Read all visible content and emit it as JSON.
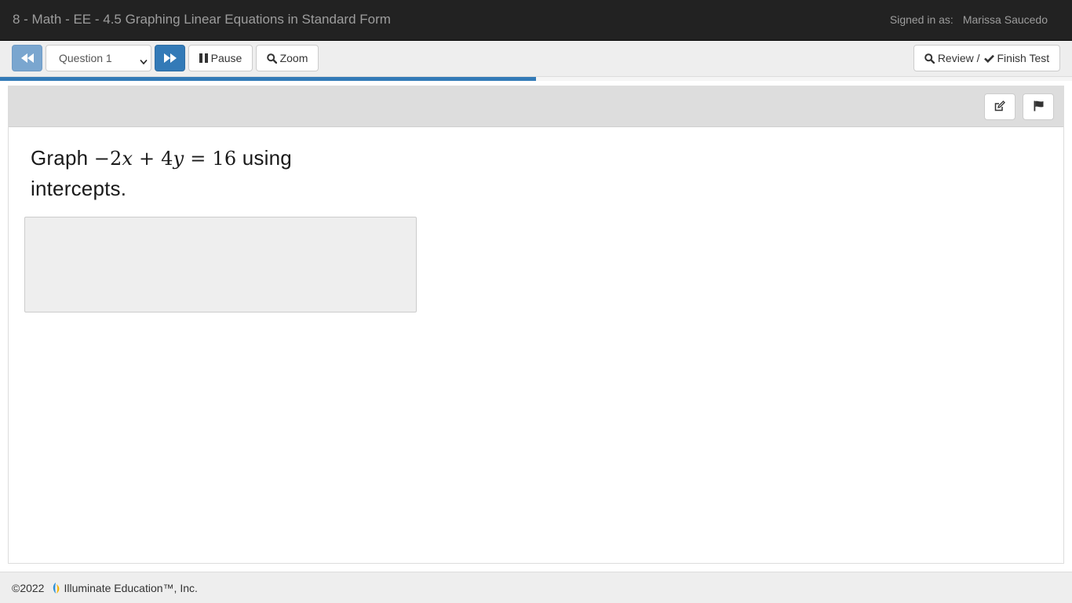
{
  "header": {
    "title": "8 - Math - EE - 4.5 Graphing Linear Equations in Standard Form",
    "signed_in_label": "Signed in as:",
    "user_name": "Marissa Saucedo"
  },
  "toolbar": {
    "prev_icon": "fast-backward-icon",
    "question_select_value": "Question 1",
    "next_icon": "fast-forward-icon",
    "pause_label": "Pause",
    "zoom_label": "Zoom",
    "review_label": "Review /",
    "finish_label": "Finish Test"
  },
  "progress": {
    "fraction": 0.5,
    "color": "#337ab7"
  },
  "question": {
    "prefix": "Graph ",
    "coef_x": "−2",
    "var_x": "x",
    "plus": " + 4",
    "var_y": "y",
    "rhs": " = 16",
    "suffix": " using intercepts."
  },
  "panel": {
    "notes_icon": "edit-icon",
    "flag_icon": "flag-icon"
  },
  "footer": {
    "copyright": "©2022",
    "company": "Illuminate Education™, Inc."
  },
  "colors": {
    "header_bg": "#222222",
    "primary": "#337ab7",
    "toolbar_bg": "#eeeeee"
  }
}
